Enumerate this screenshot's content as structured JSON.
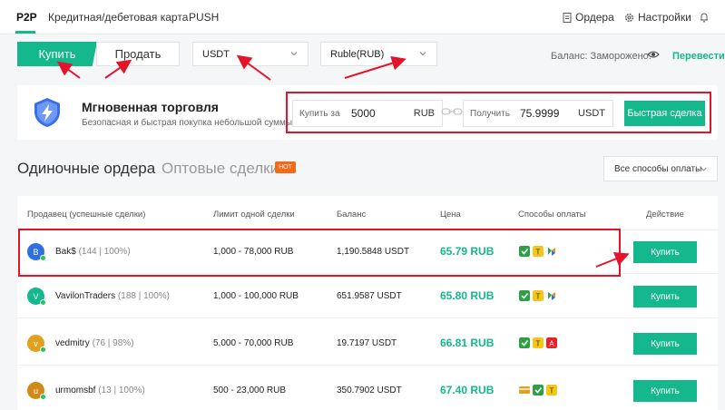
{
  "nav": {
    "items": [
      "P2P",
      "Кредитная/дебетовая карта",
      "PUSH"
    ],
    "orders": "Ордера",
    "settings": "Настройки"
  },
  "trade": {
    "buy": "Купить",
    "sell": "Продать",
    "crypto": "USDT",
    "fiat": "Ruble(RUB)",
    "balance": "Баланс: Заморожено:",
    "transfer": "Перевести"
  },
  "quick": {
    "title": "Мгновенная торговля",
    "subtitle": "Безопасная и быстрая покупка небольшой суммы",
    "pay_label": "Купить за",
    "pay_value": "5000",
    "pay_currency": "RUB",
    "get_label": "Получить",
    "get_value": "75.9999",
    "get_currency": "USDT",
    "button": "Быстрая сделка"
  },
  "section": {
    "title": "Одиночные ордера",
    "tab": "Оптовые сделки",
    "hot": "HOT",
    "pay_filter": "Все способы оплаты"
  },
  "table": {
    "headers": [
      "Продавец (успешные сделки)",
      "Лимит одной сделки",
      "Баланс",
      "Цена",
      "Способы оплаты",
      "Действие"
    ],
    "rows": [
      {
        "initial": "B",
        "avatar_color": "#2f6fe0",
        "name": "Bak$",
        "stats": "(144 | 100%)",
        "limit": "1,000 - 78,000 RUB",
        "balance": "1,190.5848 USDT",
        "price": "65.79 RUB",
        "action": "Купить"
      },
      {
        "initial": "V",
        "avatar_color": "#14b88c",
        "name": "VavilonTraders",
        "stats": "(188 | 100%)",
        "limit": "1,000 - 100,000 RUB",
        "balance": "651.9587 USDT",
        "price": "65.80 RUB",
        "action": "Купить"
      },
      {
        "initial": "v",
        "avatar_color": "#e0a020",
        "name": "vedmitry",
        "stats": "(76 | 98%)",
        "limit": "5,000 - 70,000 RUB",
        "balance": "19.7197 USDT",
        "price": "66.81 RUB",
        "action": "Купить"
      },
      {
        "initial": "u",
        "avatar_color": "#d08a1a",
        "name": "urmomsbf",
        "stats": "(13 | 100%)",
        "limit": "500 - 23,000 RUB",
        "balance": "350.7902 USDT",
        "price": "67.40 RUB",
        "action": "Купить"
      }
    ]
  },
  "colors": {
    "accent": "#14b88c",
    "annotation": "#e3142a"
  }
}
